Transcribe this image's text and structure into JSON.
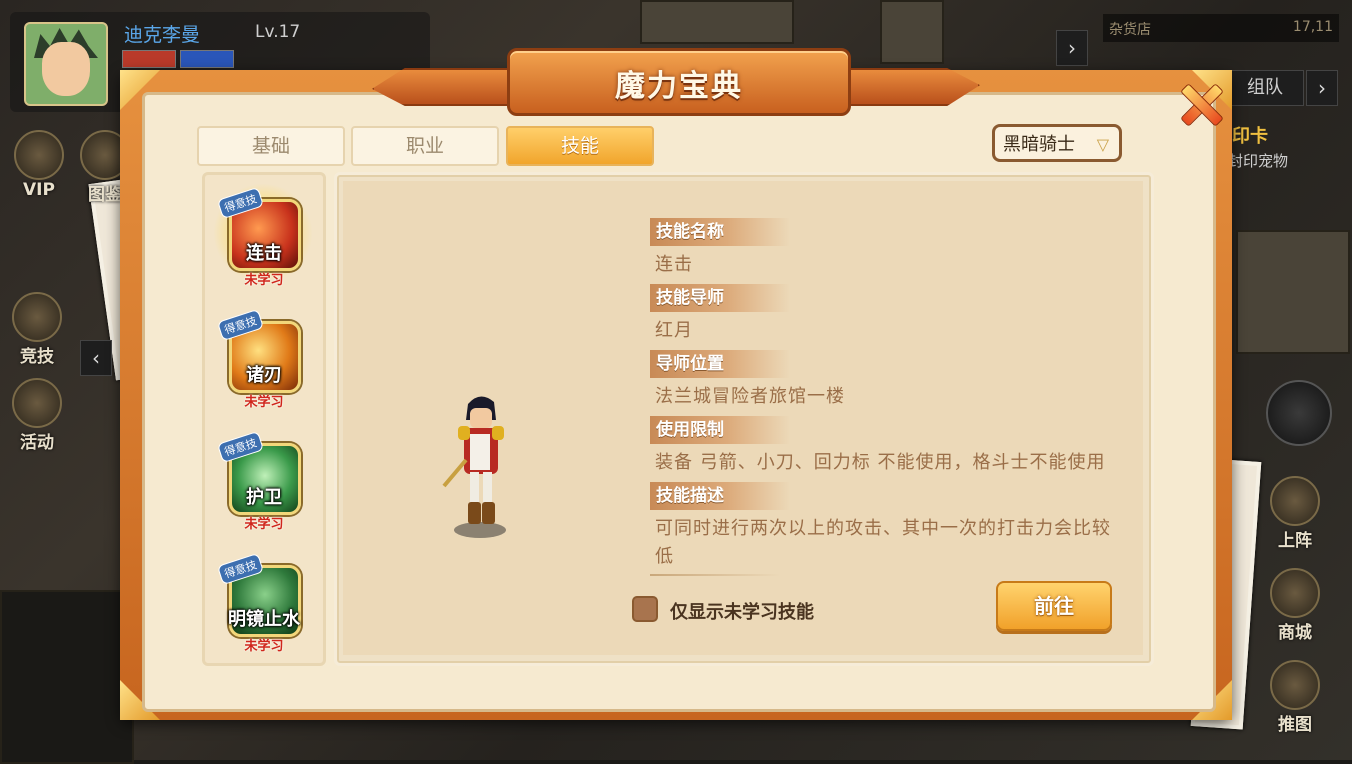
{
  "player": {
    "name": "迪克李曼",
    "level": "Lv.17"
  },
  "location": {
    "name": "杂货店",
    "coords": "17,11"
  },
  "left_menu": [
    {
      "label": "VIP"
    },
    {
      "label": "图鉴"
    },
    {
      "label": "竞技"
    },
    {
      "label": "活动"
    }
  ],
  "right_menu": [
    {
      "label": "组队"
    },
    {
      "label": "印卡"
    },
    {
      "label": "封印宠物"
    },
    {
      "label": "上阵"
    },
    {
      "label": "商城"
    },
    {
      "label": "推图"
    }
  ],
  "dialog": {
    "title": "魔力宝典",
    "tabs": [
      {
        "label": "基础",
        "active": false
      },
      {
        "label": "职业",
        "active": false
      },
      {
        "label": "技能",
        "active": true
      }
    ],
    "job_select": "黑暗骑士",
    "skills": [
      {
        "badge": "得意技",
        "name": "连击",
        "state": "未学习",
        "selected": true,
        "color": "#c8321c"
      },
      {
        "badge": "得意技",
        "name": "诸刃",
        "state": "未学习",
        "selected": false,
        "color": "#d86a18"
      },
      {
        "badge": "得意技",
        "name": "护卫",
        "state": "未学习",
        "selected": false,
        "color": "#3a9a4a"
      },
      {
        "badge": "得意技",
        "name": "明镜止水",
        "state": "未学习",
        "selected": false,
        "color": "#2f7a3c"
      }
    ],
    "fields": [
      {
        "label": "技能名称",
        "value": "连击"
      },
      {
        "label": "技能导师",
        "value": "红月"
      },
      {
        "label": "导师位置",
        "value": "法兰城冒险者旅馆一楼"
      },
      {
        "label": "使用限制",
        "value": "装备 弓箭、小刀、回力标 不能使用，格斗士不能使用"
      },
      {
        "label": "技能描述",
        "value": "可同时进行两次以上的攻击、其中一次的打击力会比较",
        "value2": "低"
      }
    ],
    "checkbox_label": "仅显示未学习技能",
    "go_button": "前往"
  }
}
